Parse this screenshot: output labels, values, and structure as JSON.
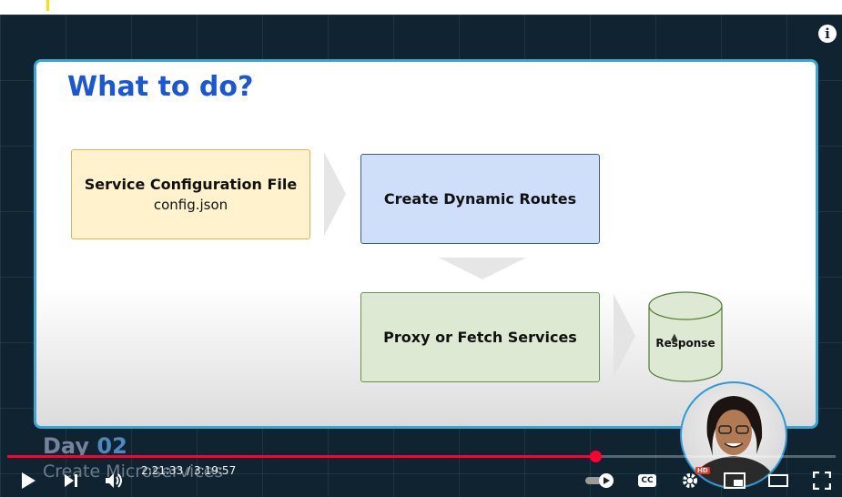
{
  "slide": {
    "title": "What to do?",
    "boxes": [
      {
        "title": "Service Configuration File",
        "subtitle": "config.json"
      },
      {
        "title": "Create Dynamic Routes"
      },
      {
        "title": "Proxy or Fetch Services"
      }
    ],
    "response_label": "Response"
  },
  "caption": {
    "line1_prefix": "Day ",
    "line1_highlight": "02",
    "line2": "Create Microservices"
  },
  "player": {
    "current_time": "2:21:33",
    "separator": " / ",
    "duration": "3:19:57",
    "progress_fraction": 0.71,
    "cc_label": "CC",
    "hd_badge": "HD",
    "info_glyph": "i",
    "accent_color": "#ff0033"
  },
  "icons": [
    "info-icon",
    "play-icon",
    "next-icon",
    "volume-icon",
    "autoplay-toggle-icon",
    "captions-icon",
    "settings-icon",
    "miniplayer-icon",
    "theater-mode-icon",
    "fullscreen-icon"
  ]
}
